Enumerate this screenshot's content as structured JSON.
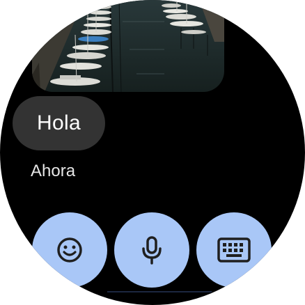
{
  "message": {
    "text": "Hola",
    "timestamp": "Ahora",
    "attachment": "harbor-photo"
  },
  "actions": [
    {
      "name": "emoji",
      "icon": "emoji-icon"
    },
    {
      "name": "voice",
      "icon": "microphone-icon"
    },
    {
      "name": "keyboard",
      "icon": "keyboard-icon"
    }
  ],
  "colors": {
    "background": "#000000",
    "bubble": "#333333",
    "action_button": "#a9c7f7",
    "icon": "#1f1f1f"
  }
}
